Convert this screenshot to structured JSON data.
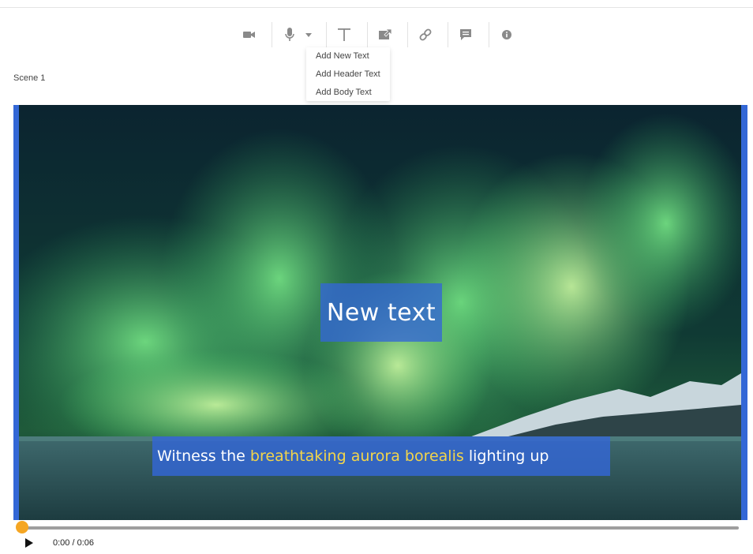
{
  "toolbar": {
    "items": [
      {
        "icon": "video-camera-icon"
      },
      {
        "icon": "microphone-icon"
      },
      {
        "icon": "caret-down-icon"
      },
      {
        "icon": "text-icon"
      },
      {
        "icon": "export-image-icon"
      },
      {
        "icon": "link-icon"
      },
      {
        "icon": "comment-icon"
      },
      {
        "icon": "info-icon"
      }
    ],
    "icon_color": "#8a8a8a"
  },
  "text_menu": {
    "items": [
      "Add New Text",
      "Add Header Text",
      "Add Body Text"
    ]
  },
  "scene": {
    "label": "Scene 1"
  },
  "canvas": {
    "headline_text": "New text",
    "caption": {
      "before": "Witness the",
      "highlight": "breathtaking aurora borealis",
      "after": "lighting up"
    },
    "accent_color": "#3367d6",
    "highlight_color": "#f3d54a"
  },
  "player": {
    "time": "0:00 / 0:06",
    "progress": 0,
    "accent_color": "#f5a623"
  }
}
